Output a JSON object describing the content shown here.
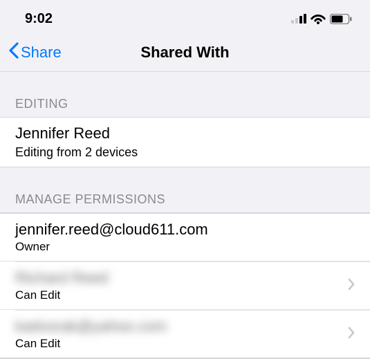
{
  "status_bar": {
    "time": "9:02"
  },
  "nav": {
    "back_label": "Share",
    "title": "Shared With"
  },
  "sections": {
    "editing": {
      "header": "EDITING",
      "user_name": "Jennifer Reed",
      "status": "Editing from 2 devices"
    },
    "permissions": {
      "header": "MANAGE PERMISSIONS",
      "items": [
        {
          "title": "jennifer.reed@cloud611.com",
          "role": "Owner",
          "blurred": false,
          "chevron": false
        },
        {
          "title": "Richard Reed",
          "role": "Can Edit",
          "blurred": true,
          "chevron": true
        },
        {
          "title": "kadvorak@yahoo.com",
          "role": "Can Edit",
          "blurred": true,
          "chevron": true
        }
      ]
    }
  }
}
